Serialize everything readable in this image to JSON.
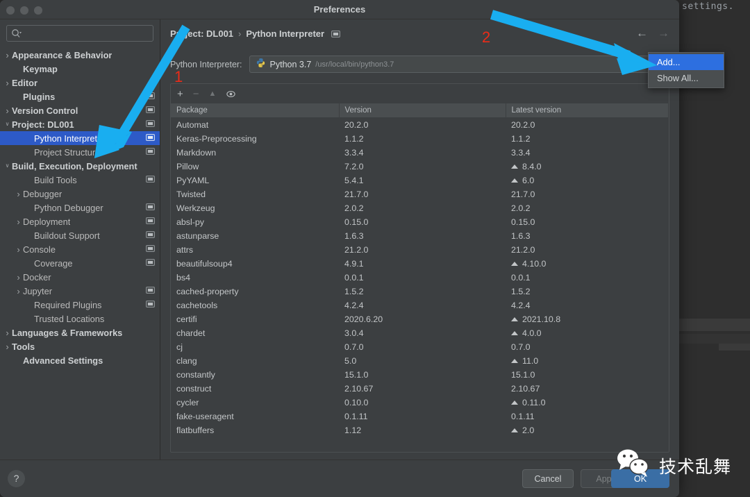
{
  "background": {
    "code_text": "settings."
  },
  "window": {
    "title": "Preferences",
    "traffic_lights": [
      "close-button",
      "minimize-button",
      "zoom-button"
    ]
  },
  "sidebar": {
    "search": {
      "value": "",
      "placeholder": "",
      "icon": "search-icon"
    },
    "items": [
      {
        "label": "Appearance & Behavior",
        "indent": 0,
        "arrow": "collapsed",
        "bold": true,
        "chip": false,
        "selected": false
      },
      {
        "label": "Keymap",
        "indent": 1,
        "arrow": "none",
        "bold": true,
        "chip": false,
        "selected": false
      },
      {
        "label": "Editor",
        "indent": 0,
        "arrow": "collapsed",
        "bold": true,
        "chip": false,
        "selected": false
      },
      {
        "label": "Plugins",
        "indent": 1,
        "arrow": "none",
        "bold": true,
        "chip": true,
        "selected": false
      },
      {
        "label": "Version Control",
        "indent": 0,
        "arrow": "collapsed",
        "bold": true,
        "chip": true,
        "selected": false
      },
      {
        "label": "Project: DL001",
        "indent": 0,
        "arrow": "expanded",
        "bold": true,
        "chip": true,
        "selected": false
      },
      {
        "label": "Python Interpreter",
        "indent": 2,
        "arrow": "none",
        "bold": false,
        "chip": true,
        "selected": true
      },
      {
        "label": "Project Structure",
        "indent": 2,
        "arrow": "none",
        "bold": false,
        "chip": true,
        "selected": false
      },
      {
        "label": "Build, Execution, Deployment",
        "indent": 0,
        "arrow": "expanded",
        "bold": true,
        "chip": false,
        "selected": false
      },
      {
        "label": "Build Tools",
        "indent": 2,
        "arrow": "none",
        "bold": false,
        "chip": true,
        "selected": false
      },
      {
        "label": "Debugger",
        "indent": 1,
        "arrow": "collapsed",
        "bold": false,
        "chip": false,
        "selected": false
      },
      {
        "label": "Python Debugger",
        "indent": 2,
        "arrow": "none",
        "bold": false,
        "chip": true,
        "selected": false
      },
      {
        "label": "Deployment",
        "indent": 1,
        "arrow": "collapsed",
        "bold": false,
        "chip": true,
        "selected": false
      },
      {
        "label": "Buildout Support",
        "indent": 2,
        "arrow": "none",
        "bold": false,
        "chip": true,
        "selected": false
      },
      {
        "label": "Console",
        "indent": 1,
        "arrow": "collapsed",
        "bold": false,
        "chip": true,
        "selected": false
      },
      {
        "label": "Coverage",
        "indent": 2,
        "arrow": "none",
        "bold": false,
        "chip": true,
        "selected": false
      },
      {
        "label": "Docker",
        "indent": 1,
        "arrow": "collapsed",
        "bold": false,
        "chip": false,
        "selected": false
      },
      {
        "label": "Jupyter",
        "indent": 1,
        "arrow": "collapsed",
        "bold": false,
        "chip": true,
        "selected": false
      },
      {
        "label": "Required Plugins",
        "indent": 2,
        "arrow": "none",
        "bold": false,
        "chip": true,
        "selected": false
      },
      {
        "label": "Trusted Locations",
        "indent": 2,
        "arrow": "none",
        "bold": false,
        "chip": false,
        "selected": false
      },
      {
        "label": "Languages & Frameworks",
        "indent": 0,
        "arrow": "collapsed",
        "bold": true,
        "chip": false,
        "selected": false
      },
      {
        "label": "Tools",
        "indent": 0,
        "arrow": "collapsed",
        "bold": true,
        "chip": false,
        "selected": false
      },
      {
        "label": "Advanced Settings",
        "indent": 1,
        "arrow": "none",
        "bold": true,
        "chip": false,
        "selected": false
      }
    ]
  },
  "content": {
    "breadcrumb": {
      "root": "Project: DL001",
      "separator": "›",
      "leaf": "Python Interpreter"
    },
    "nav": {
      "back": "←",
      "forward": "→"
    },
    "interpreter": {
      "label": "Python Interpreter:",
      "name": "Python 3.7",
      "path": "/usr/local/bin/python3.7",
      "icon": "python-icon"
    },
    "toolbar": {
      "add": "+",
      "remove": "−",
      "upgrade": "▲",
      "eye": "eye-icon"
    },
    "table": {
      "columns": [
        "Package",
        "Version",
        "Latest version"
      ],
      "rows": [
        {
          "package": "Automat",
          "version": "20.2.0",
          "latest": "20.2.0",
          "upgradable": false
        },
        {
          "package": "Keras-Preprocessing",
          "version": "1.1.2",
          "latest": "1.1.2",
          "upgradable": false
        },
        {
          "package": "Markdown",
          "version": "3.3.4",
          "latest": "3.3.4",
          "upgradable": false
        },
        {
          "package": "Pillow",
          "version": "7.2.0",
          "latest": "8.4.0",
          "upgradable": true
        },
        {
          "package": "PyYAML",
          "version": "5.4.1",
          "latest": "6.0",
          "upgradable": true
        },
        {
          "package": "Twisted",
          "version": "21.7.0",
          "latest": "21.7.0",
          "upgradable": false
        },
        {
          "package": "Werkzeug",
          "version": "2.0.2",
          "latest": "2.0.2",
          "upgradable": false
        },
        {
          "package": "absl-py",
          "version": "0.15.0",
          "latest": "0.15.0",
          "upgradable": false
        },
        {
          "package": "astunparse",
          "version": "1.6.3",
          "latest": "1.6.3",
          "upgradable": false
        },
        {
          "package": "attrs",
          "version": "21.2.0",
          "latest": "21.2.0",
          "upgradable": false
        },
        {
          "package": "beautifulsoup4",
          "version": "4.9.1",
          "latest": "4.10.0",
          "upgradable": true
        },
        {
          "package": "bs4",
          "version": "0.0.1",
          "latest": "0.0.1",
          "upgradable": false
        },
        {
          "package": "cached-property",
          "version": "1.5.2",
          "latest": "1.5.2",
          "upgradable": false
        },
        {
          "package": "cachetools",
          "version": "4.2.4",
          "latest": "4.2.4",
          "upgradable": false
        },
        {
          "package": "certifi",
          "version": "2020.6.20",
          "latest": "2021.10.8",
          "upgradable": true
        },
        {
          "package": "chardet",
          "version": "3.0.4",
          "latest": "4.0.0",
          "upgradable": true
        },
        {
          "package": "cj",
          "version": "0.7.0",
          "latest": "0.7.0",
          "upgradable": false
        },
        {
          "package": "clang",
          "version": "5.0",
          "latest": "11.0",
          "upgradable": true
        },
        {
          "package": "constantly",
          "version": "15.1.0",
          "latest": "15.1.0",
          "upgradable": false
        },
        {
          "package": "construct",
          "version": "2.10.67",
          "latest": "2.10.67",
          "upgradable": false
        },
        {
          "package": "cycler",
          "version": "0.10.0",
          "latest": "0.11.0",
          "upgradable": true
        },
        {
          "package": "fake-useragent",
          "version": "0.1.11",
          "latest": "0.1.11",
          "upgradable": false
        },
        {
          "package": "flatbuffers",
          "version": "1.12",
          "latest": "2.0",
          "upgradable": true
        }
      ]
    }
  },
  "popup": {
    "items": [
      {
        "label": "Add...",
        "active": true
      },
      {
        "label": "Show All...",
        "active": false
      }
    ]
  },
  "footer": {
    "help": "?",
    "cancel": "Cancel",
    "apply": "Apply",
    "ok": "OK"
  },
  "annotations": {
    "step_one": "1",
    "step_two": "2",
    "arrow_color": "#19aef0",
    "number_color": "#ec2b18"
  },
  "watermark": {
    "text": "技术乱舞",
    "icon": "wechat-icon"
  }
}
